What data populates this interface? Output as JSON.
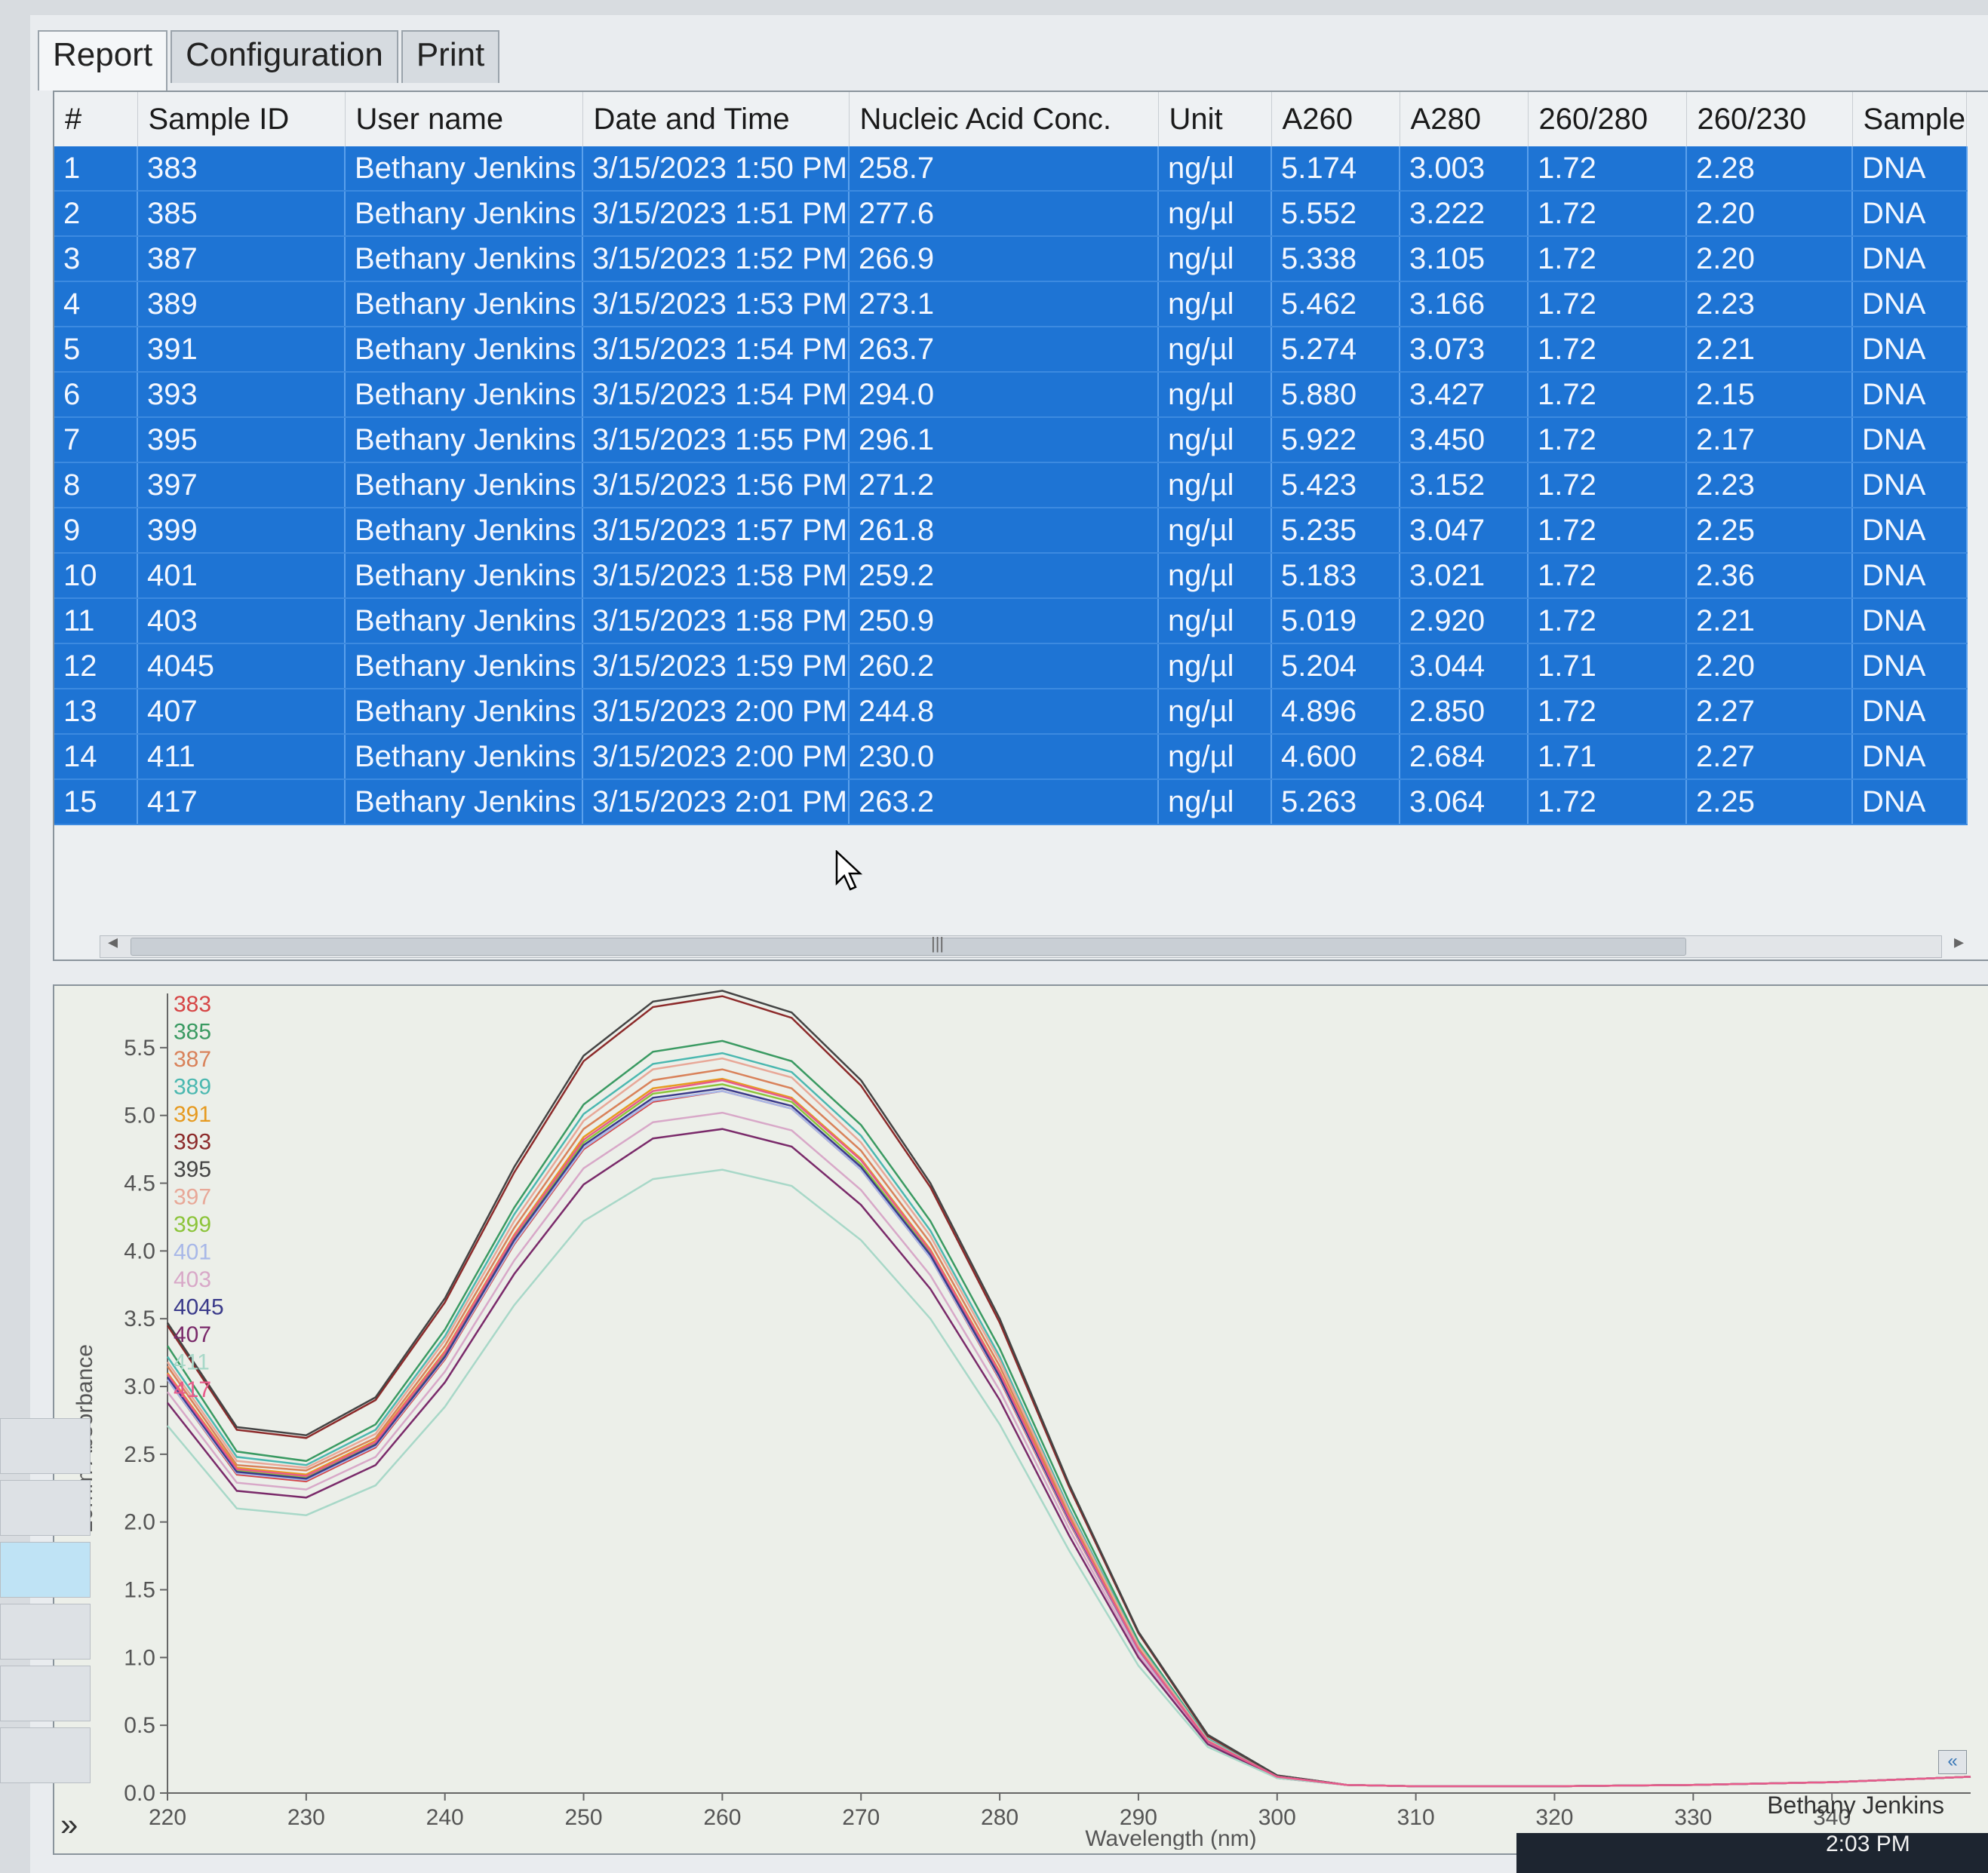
{
  "tabs": [
    "Report",
    "Configuration",
    "Print"
  ],
  "table": {
    "columns": [
      "#",
      "Sample ID",
      "User name",
      "Date and Time",
      "Nucleic Acid Conc.",
      "Unit",
      "A260",
      "A280",
      "260/280",
      "260/230",
      "Sample"
    ],
    "rows": [
      [
        "1",
        "383",
        "Bethany Jenkins",
        "3/15/2023 1:50 PM",
        "258.7",
        "ng/µl",
        "5.174",
        "3.003",
        "1.72",
        "2.28",
        "DNA"
      ],
      [
        "2",
        "385",
        "Bethany Jenkins",
        "3/15/2023 1:51 PM",
        "277.6",
        "ng/µl",
        "5.552",
        "3.222",
        "1.72",
        "2.20",
        "DNA"
      ],
      [
        "3",
        "387",
        "Bethany Jenkins",
        "3/15/2023 1:52 PM",
        "266.9",
        "ng/µl",
        "5.338",
        "3.105",
        "1.72",
        "2.20",
        "DNA"
      ],
      [
        "4",
        "389",
        "Bethany Jenkins",
        "3/15/2023 1:53 PM",
        "273.1",
        "ng/µl",
        "5.462",
        "3.166",
        "1.72",
        "2.23",
        "DNA"
      ],
      [
        "5",
        "391",
        "Bethany Jenkins",
        "3/15/2023 1:54 PM",
        "263.7",
        "ng/µl",
        "5.274",
        "3.073",
        "1.72",
        "2.21",
        "DNA"
      ],
      [
        "6",
        "393",
        "Bethany Jenkins",
        "3/15/2023 1:54 PM",
        "294.0",
        "ng/µl",
        "5.880",
        "3.427",
        "1.72",
        "2.15",
        "DNA"
      ],
      [
        "7",
        "395",
        "Bethany Jenkins",
        "3/15/2023 1:55 PM",
        "296.1",
        "ng/µl",
        "5.922",
        "3.450",
        "1.72",
        "2.17",
        "DNA"
      ],
      [
        "8",
        "397",
        "Bethany Jenkins",
        "3/15/2023 1:56 PM",
        "271.2",
        "ng/µl",
        "5.423",
        "3.152",
        "1.72",
        "2.23",
        "DNA"
      ],
      [
        "9",
        "399",
        "Bethany Jenkins",
        "3/15/2023 1:57 PM",
        "261.8",
        "ng/µl",
        "5.235",
        "3.047",
        "1.72",
        "2.25",
        "DNA"
      ],
      [
        "10",
        "401",
        "Bethany Jenkins",
        "3/15/2023 1:58 PM",
        "259.2",
        "ng/µl",
        "5.183",
        "3.021",
        "1.72",
        "2.36",
        "DNA"
      ],
      [
        "11",
        "403",
        "Bethany Jenkins",
        "3/15/2023 1:58 PM",
        "250.9",
        "ng/µl",
        "5.019",
        "2.920",
        "1.72",
        "2.21",
        "DNA"
      ],
      [
        "12",
        "4045",
        "Bethany Jenkins",
        "3/15/2023 1:59 PM",
        "260.2",
        "ng/µl",
        "5.204",
        "3.044",
        "1.71",
        "2.20",
        "DNA"
      ],
      [
        "13",
        "407",
        "Bethany Jenkins",
        "3/15/2023 2:00 PM",
        "244.8",
        "ng/µl",
        "4.896",
        "2.850",
        "1.72",
        "2.27",
        "DNA"
      ],
      [
        "14",
        "411",
        "Bethany Jenkins",
        "3/15/2023 2:00 PM",
        "230.0",
        "ng/µl",
        "4.600",
        "2.684",
        "1.71",
        "2.27",
        "DNA"
      ],
      [
        "15",
        "417",
        "Bethany Jenkins",
        "3/15/2023 2:01 PM",
        "263.2",
        "ng/µl",
        "5.263",
        "3.064",
        "1.72",
        "2.25",
        "DNA"
      ]
    ],
    "selection_color": "#1e74d4"
  },
  "chart_data": {
    "type": "line",
    "xlabel": "Wavelength (nm)",
    "ylabel": "10mm Absorbance",
    "xlim": [
      220,
      350
    ],
    "ylim": [
      0,
      5.9
    ],
    "x_ticks": [
      220,
      230,
      240,
      250,
      260,
      270,
      280,
      290,
      300,
      310,
      320,
      330,
      340
    ],
    "y_ticks": [
      "0.0",
      "0.5",
      "1.0",
      "1.5",
      "2.0",
      "2.5",
      "3.0",
      "3.5",
      "4.0",
      "4.5",
      "5.0",
      "5.5"
    ],
    "legend_position": "top-left",
    "x": [
      220,
      225,
      230,
      235,
      240,
      245,
      250,
      255,
      260,
      265,
      270,
      275,
      280,
      285,
      290,
      295,
      300,
      305,
      310,
      320,
      330,
      340,
      350
    ],
    "series": [
      {
        "name": "383",
        "color": "#d64545",
        "values": [
          3.05,
          2.35,
          2.3,
          2.55,
          3.2,
          4.05,
          4.75,
          5.1,
          5.18,
          5.05,
          4.6,
          3.95,
          3.05,
          2.0,
          1.05,
          0.38,
          0.12,
          0.06,
          0.05,
          0.05,
          0.06,
          0.08,
          0.12
        ]
      },
      {
        "name": "385",
        "color": "#3a9a62",
        "values": [
          3.3,
          2.52,
          2.45,
          2.72,
          3.42,
          4.32,
          5.08,
          5.47,
          5.55,
          5.4,
          4.93,
          4.22,
          3.28,
          2.15,
          1.12,
          0.4,
          0.12,
          0.06,
          0.05,
          0.05,
          0.06,
          0.08,
          0.12
        ]
      },
      {
        "name": "387",
        "color": "#d9825a",
        "values": [
          3.15,
          2.42,
          2.38,
          2.62,
          3.3,
          4.17,
          4.9,
          5.26,
          5.34,
          5.2,
          4.74,
          4.06,
          3.15,
          2.06,
          1.08,
          0.39,
          0.12,
          0.06,
          0.05,
          0.05,
          0.06,
          0.08,
          0.12
        ]
      },
      {
        "name": "389",
        "color": "#4bb8b0",
        "values": [
          3.22,
          2.48,
          2.42,
          2.68,
          3.37,
          4.27,
          5.01,
          5.38,
          5.46,
          5.32,
          4.85,
          4.15,
          3.22,
          2.1,
          1.1,
          0.4,
          0.12,
          0.06,
          0.05,
          0.05,
          0.06,
          0.08,
          0.12
        ]
      },
      {
        "name": "391",
        "color": "#e69a20",
        "values": [
          3.1,
          2.4,
          2.35,
          2.6,
          3.26,
          4.12,
          4.84,
          5.2,
          5.27,
          5.13,
          4.68,
          4.01,
          3.11,
          2.04,
          1.07,
          0.38,
          0.12,
          0.06,
          0.05,
          0.05,
          0.06,
          0.08,
          0.12
        ]
      },
      {
        "name": "393",
        "color": "#8c2a2a",
        "values": [
          3.45,
          2.68,
          2.62,
          2.9,
          3.62,
          4.58,
          5.4,
          5.8,
          5.88,
          5.72,
          5.22,
          4.47,
          3.47,
          2.26,
          1.18,
          0.42,
          0.13,
          0.06,
          0.05,
          0.05,
          0.06,
          0.08,
          0.12
        ]
      },
      {
        "name": "395",
        "color": "#444444",
        "values": [
          3.47,
          2.7,
          2.64,
          2.92,
          3.65,
          4.62,
          5.44,
          5.84,
          5.92,
          5.76,
          5.26,
          4.5,
          3.5,
          2.28,
          1.19,
          0.43,
          0.13,
          0.06,
          0.05,
          0.05,
          0.06,
          0.08,
          0.12
        ]
      },
      {
        "name": "397",
        "color": "#e8a898",
        "values": [
          3.18,
          2.45,
          2.4,
          2.65,
          3.34,
          4.22,
          4.96,
          5.34,
          5.42,
          5.28,
          4.8,
          4.11,
          3.19,
          2.08,
          1.09,
          0.39,
          0.12,
          0.06,
          0.05,
          0.05,
          0.06,
          0.08,
          0.12
        ]
      },
      {
        "name": "399",
        "color": "#8cc43a",
        "values": [
          3.08,
          2.38,
          2.33,
          2.58,
          3.24,
          4.09,
          4.8,
          5.16,
          5.23,
          5.1,
          4.64,
          3.98,
          3.09,
          2.03,
          1.06,
          0.38,
          0.12,
          0.06,
          0.05,
          0.05,
          0.06,
          0.08,
          0.12
        ]
      },
      {
        "name": "401",
        "color": "#a8b8e8",
        "values": [
          3.05,
          2.36,
          2.31,
          2.56,
          3.21,
          4.06,
          4.76,
          5.11,
          5.18,
          5.05,
          4.6,
          3.95,
          3.06,
          2.01,
          1.05,
          0.38,
          0.12,
          0.06,
          0.05,
          0.05,
          0.06,
          0.08,
          0.12
        ]
      },
      {
        "name": "403",
        "color": "#d8a8c8",
        "values": [
          2.96,
          2.29,
          2.24,
          2.48,
          3.11,
          3.93,
          4.61,
          4.95,
          5.02,
          4.89,
          4.45,
          3.82,
          2.97,
          1.95,
          1.02,
          0.37,
          0.12,
          0.06,
          0.05,
          0.05,
          0.06,
          0.08,
          0.12
        ]
      },
      {
        "name": "4045",
        "color": "#3a3a8a",
        "values": [
          3.07,
          2.37,
          2.32,
          2.57,
          3.22,
          4.08,
          4.78,
          5.13,
          5.2,
          5.07,
          4.62,
          3.97,
          3.07,
          2.02,
          1.06,
          0.38,
          0.12,
          0.06,
          0.05,
          0.05,
          0.06,
          0.08,
          0.12
        ]
      },
      {
        "name": "407",
        "color": "#7a2a6a",
        "values": [
          2.88,
          2.23,
          2.18,
          2.42,
          3.03,
          3.83,
          4.49,
          4.83,
          4.9,
          4.77,
          4.34,
          3.72,
          2.9,
          1.9,
          1.0,
          0.36,
          0.11,
          0.06,
          0.05,
          0.05,
          0.06,
          0.08,
          0.12
        ]
      },
      {
        "name": "411",
        "color": "#a8d8c8",
        "values": [
          2.71,
          2.1,
          2.05,
          2.27,
          2.85,
          3.6,
          4.22,
          4.53,
          4.6,
          4.48,
          4.08,
          3.5,
          2.72,
          1.79,
          0.94,
          0.34,
          0.11,
          0.06,
          0.05,
          0.05,
          0.06,
          0.08,
          0.12
        ]
      },
      {
        "name": "417",
        "color": "#e85a8a",
        "values": [
          3.09,
          2.39,
          2.34,
          2.59,
          3.25,
          4.11,
          4.82,
          5.18,
          5.26,
          5.12,
          4.67,
          4.0,
          3.1,
          2.03,
          1.06,
          0.38,
          0.12,
          0.06,
          0.05,
          0.05,
          0.06,
          0.08,
          0.12
        ]
      }
    ]
  },
  "footer": {
    "user": "Bethany Jenkins"
  },
  "taskbar": {
    "time": "2:03 PM"
  },
  "icons": {
    "scroll_grip": "|||",
    "expand": "»",
    "collapse": "«"
  }
}
